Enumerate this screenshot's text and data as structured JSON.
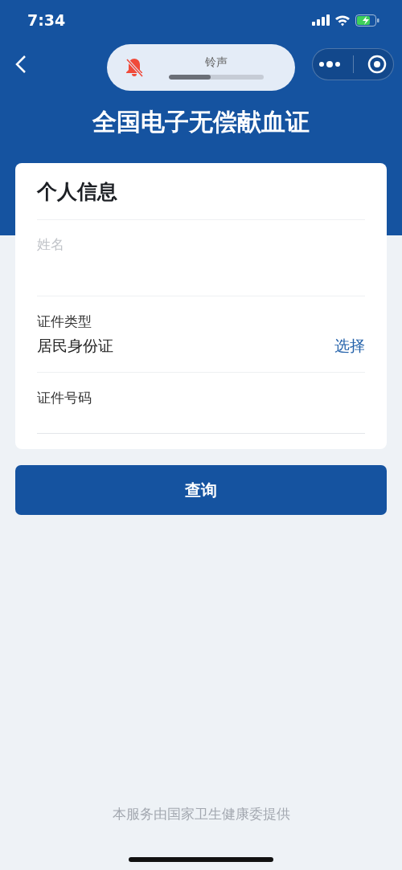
{
  "status_bar": {
    "time": "7:34"
  },
  "volume_hud": {
    "label": "铃声",
    "muted": true,
    "level": 0.44
  },
  "title": "全国电子无偿献血证",
  "card": {
    "title": "个人信息",
    "fields": [
      {
        "kind": "input",
        "placeholder": "姓名"
      },
      {
        "kind": "select",
        "label": "证件类型",
        "value": "居民身份证",
        "action": "选择"
      },
      {
        "kind": "labeled_input",
        "label": "证件号码"
      }
    ]
  },
  "submit_button": "查询",
  "footer": "本服务由国家卫生健康委提供"
}
